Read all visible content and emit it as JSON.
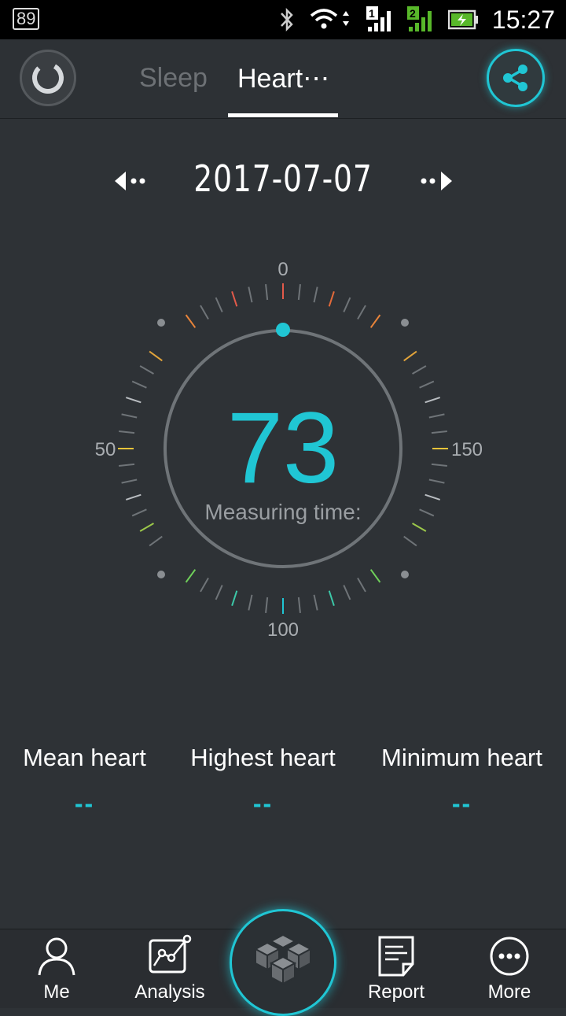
{
  "status_bar": {
    "battery_left": "89",
    "time": "15:27",
    "sim1": "1",
    "sim2": "2"
  },
  "header": {
    "tabs": [
      {
        "label": "Sleep",
        "active": false
      },
      {
        "label": "Heart⋯",
        "active": true
      }
    ]
  },
  "date": {
    "value": "2017-07-07"
  },
  "gauge": {
    "value": "73",
    "caption": "Measuring time:",
    "labels": {
      "top": "0",
      "left": "50",
      "right": "150",
      "bottom": "100"
    },
    "accent_color": "#20c6d4"
  },
  "stats": [
    {
      "label": "Mean heart",
      "value": "--"
    },
    {
      "label": "Highest heart",
      "value": "--"
    },
    {
      "label": "Minimum heart",
      "value": "--"
    }
  ],
  "bottom_nav": [
    {
      "label": "Me",
      "icon": "person-icon"
    },
    {
      "label": "Analysis",
      "icon": "analysis-chart-icon"
    },
    {
      "label": "",
      "icon": "cube-stack-icon"
    },
    {
      "label": "Report",
      "icon": "report-document-icon"
    },
    {
      "label": "More",
      "icon": "more-dots-icon"
    }
  ]
}
